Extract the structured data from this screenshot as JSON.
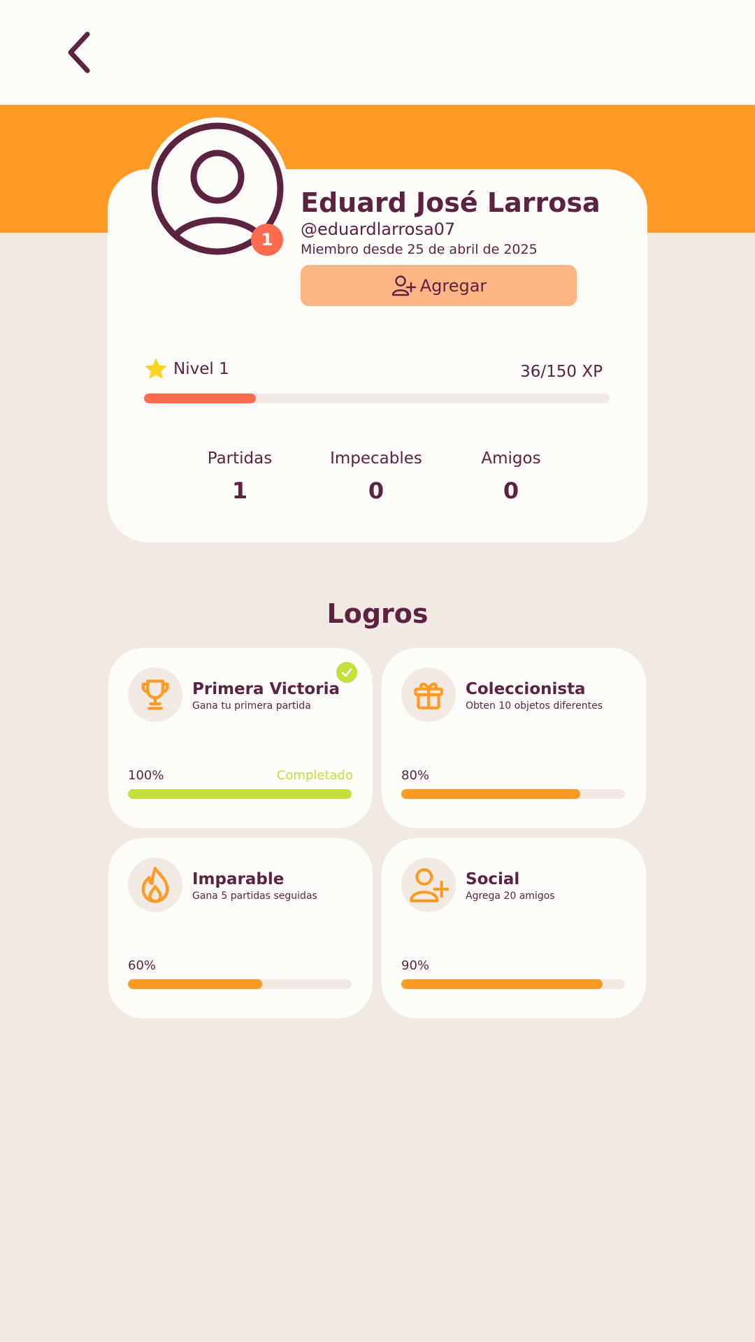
{
  "colors": {
    "brand_orange": "#ff9a24",
    "dark_plum": "#5b2340",
    "coral": "#ff6b4f",
    "light_peach": "#ffb583",
    "lime": "#c3e03c",
    "page_bg": "#f2e9e2",
    "card_bg": "#fefcf9"
  },
  "header": {
    "back_icon": "chevron-left-icon"
  },
  "profile": {
    "avatar_icon": "user-icon",
    "badge": "1",
    "name": "Eduard José Larrosa",
    "handle": "@eduardlarrosa07",
    "member_since": "Miembro desde 25 de abril de 2025",
    "add_button": {
      "icon": "user-plus-icon",
      "label": "Agregar"
    }
  },
  "level": {
    "icon": "star-icon",
    "label": "Nivel 1",
    "xp_text": "36/150 XP",
    "progress": 0.24
  },
  "stats": [
    {
      "label": "Partidas",
      "value": "1"
    },
    {
      "label": "Impecables",
      "value": "0"
    },
    {
      "label": "Amigos",
      "value": "0"
    }
  ],
  "achievements": {
    "title": "Logros",
    "items": [
      {
        "icon": "trophy-icon",
        "title": "Primera Victoria",
        "description": "Gana tu primera partida",
        "percent": "100%",
        "progress": 1.0,
        "status": "Completado",
        "completed": true
      },
      {
        "icon": "gift-icon",
        "title": "Coleccionista",
        "description": "Obten 10 objetos diferentes",
        "percent": "80%",
        "progress": 0.8,
        "completed": false
      },
      {
        "icon": "flame-icon",
        "title": "Imparable",
        "description": "Gana 5 partidas seguidas",
        "percent": "60%",
        "progress": 0.6,
        "completed": false
      },
      {
        "icon": "user-plus-icon",
        "title": "Social",
        "description": "Agrega 20 amigos",
        "percent": "90%",
        "progress": 0.9,
        "completed": false
      }
    ]
  }
}
